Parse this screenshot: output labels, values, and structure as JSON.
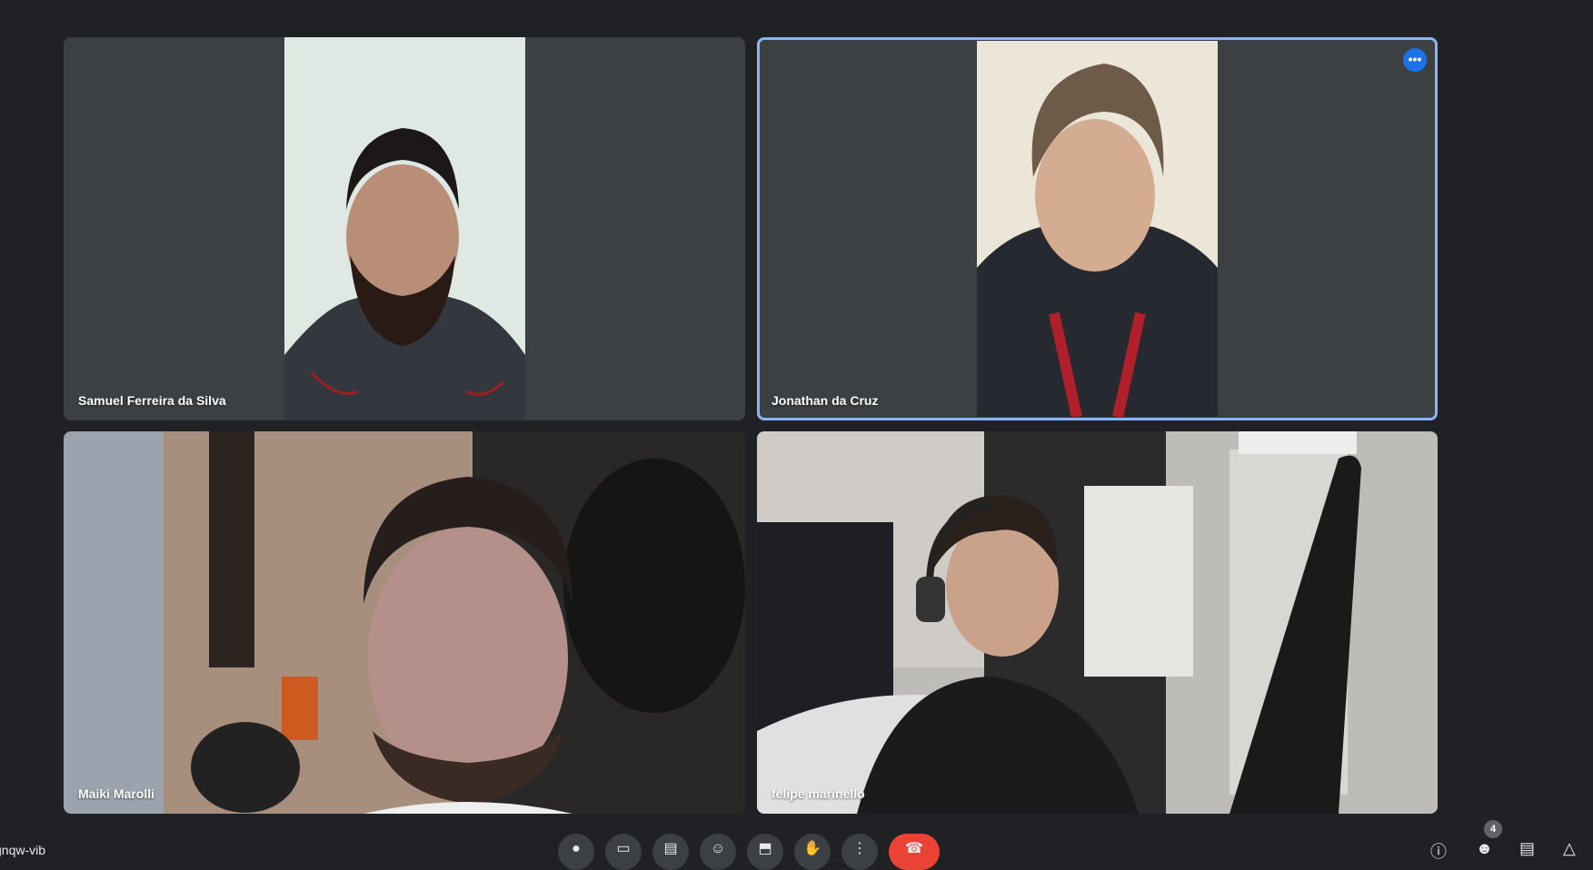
{
  "participants": [
    {
      "name": "Samuel Ferreira da Silva"
    },
    {
      "name": "Jonathan da Cruz",
      "pinned_active": true
    },
    {
      "name": "Maiki Marolli"
    },
    {
      "name": "felipe marinello"
    }
  ],
  "toolbar": {
    "meeting_code_fragment": "gnqw-vib",
    "people_count": "4",
    "controls": [
      "microphone-icon",
      "camera-icon",
      "captions-icon",
      "emoji-icon",
      "present-icon",
      "raise-hand-icon",
      "more-options-icon",
      "end-call-icon"
    ],
    "right_icons": [
      "info-icon",
      "people-icon",
      "chat-icon",
      "activities-icon"
    ]
  },
  "colors": {
    "background": "#202124",
    "tile": "#3c4043",
    "active_border": "#8ab4f8",
    "end_call": "#ea4335",
    "menu_dot": "#1a73e8"
  },
  "more_options_glyph": "•••"
}
